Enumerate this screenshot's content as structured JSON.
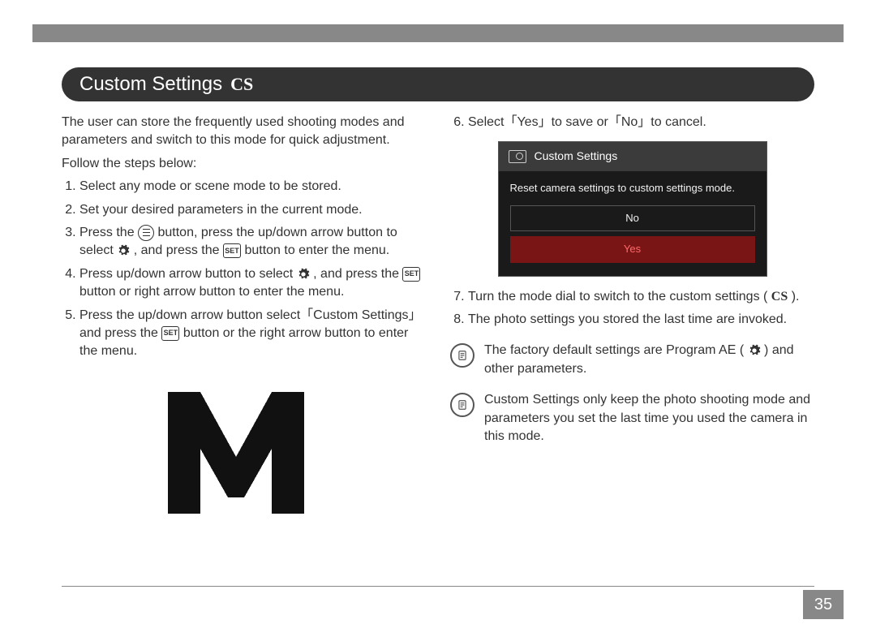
{
  "header": {
    "title": "Custom Settings",
    "badge": "CS"
  },
  "left": {
    "intro": "The user can store the frequently used shooting modes and parameters and switch to this mode for quick adjustment.",
    "follow": "Follow the steps below:",
    "steps": {
      "s1": "Select any mode or scene mode to be stored.",
      "s2": "Set your desired parameters in the current mode.",
      "s3a": "Press the ",
      "s3b": " button, press the up/down arrow button to select ",
      "s3c": " , and press the ",
      "s3d": " button to enter the menu.",
      "s4a": "Press up/down arrow button to select ",
      "s4b": ", and press the ",
      "s4c": " button or right arrow button to enter the menu.",
      "s5a": "Press the up/down arrow button select「Custom Settings」and press the ",
      "s5b": " button or the right arrow button to enter the menu."
    },
    "set_label": "SET"
  },
  "right": {
    "s6": "Select「Yes」to save or「No」to cancel.",
    "s7a": "Turn the mode dial to switch to the custom settings ( ",
    "s7_badge": "CS",
    "s7b": " ).",
    "s8": "The photo settings you stored the last time are invoked.",
    "note1a": "The factory default settings are Program AE ( ",
    "note1b": " ) and other parameters.",
    "note2": "Custom Settings only keep the photo shooting mode and parameters you set the last time you used the camera in this mode."
  },
  "screenshot": {
    "title": "Custom Settings",
    "body": "Reset camera settings to custom settings mode.",
    "opt_no": "No",
    "opt_yes": "Yes"
  },
  "page_number": "35"
}
